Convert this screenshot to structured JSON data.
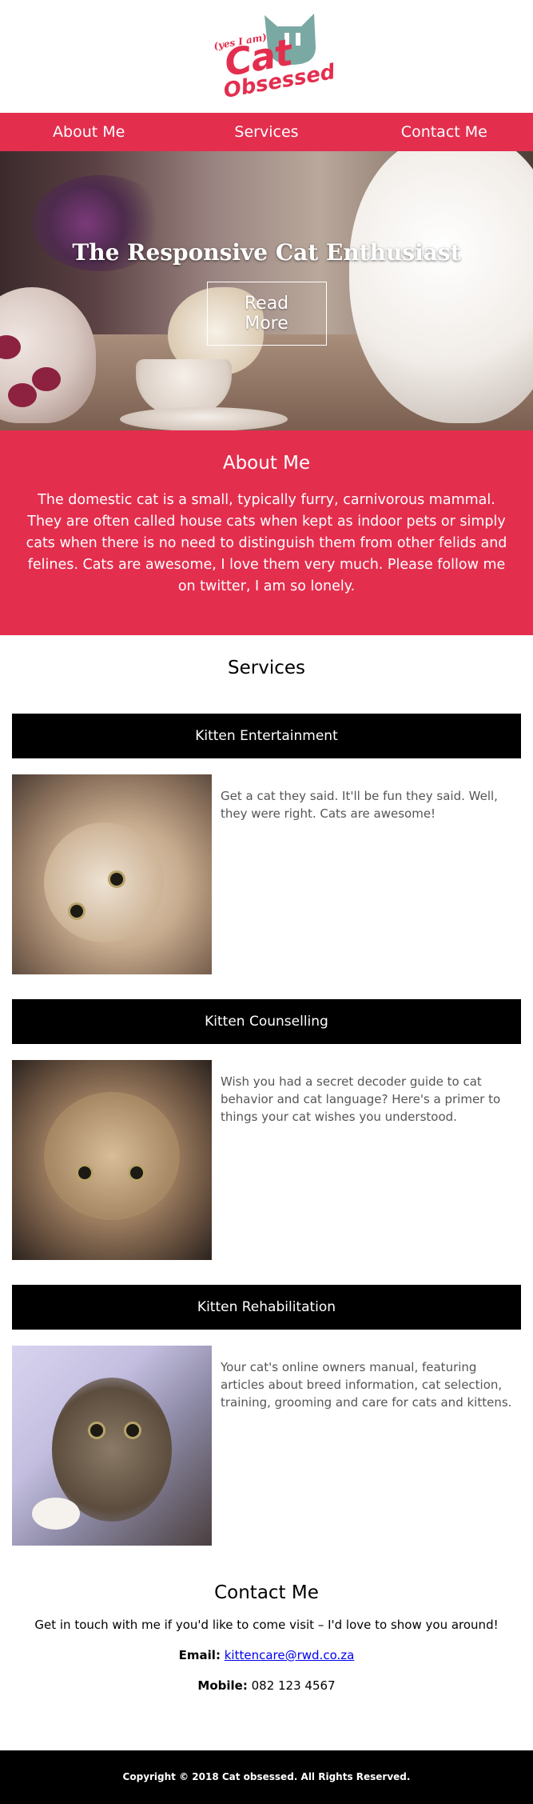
{
  "logo": {
    "tagline": "(yes I am)",
    "word1": "Cat",
    "word2": "Obsessed"
  },
  "nav": {
    "items": [
      {
        "label": "About Me"
      },
      {
        "label": "Services"
      },
      {
        "label": "Contact Me"
      }
    ]
  },
  "hero": {
    "title": "The Responsive Cat Enthusiast",
    "button_label": "Read More"
  },
  "about": {
    "title": "About Me",
    "text": "The domestic cat is a small, typically furry, carnivorous mammal. They are often called house cats when kept as indoor pets or simply cats when there is no need to distinguish them from other felids and felines. Cats are awesome, I love them very much. Please follow me on twitter, I am so lonely."
  },
  "services": {
    "title": "Services",
    "items": [
      {
        "heading": "Kitten Entertainment",
        "text": "Get a cat they said. It'll be fun they said. Well, they were right. Cats are awesome!"
      },
      {
        "heading": "Kitten Counselling",
        "text": "Wish you had a secret decoder guide to cat behavior and cat language? Here's a primer to things your cat wishes you understood."
      },
      {
        "heading": "Kitten Rehabilitation",
        "text": "Your cat's online owners manual, featuring articles about breed information, cat selection, training, grooming and care for cats and kittens."
      }
    ]
  },
  "contact": {
    "title": "Contact Me",
    "intro": "Get in touch with me if you'd like to come visit – I'd love to show you around!",
    "email_label": "Email:",
    "email": "kittencare@rwd.co.za",
    "mobile_label": "Mobile:",
    "mobile": "082 123 4567"
  },
  "footer": {
    "copyright": "Copyright © 2018 Cat obsessed. All Rights Reserved."
  },
  "colors": {
    "brand": "#e42e4e",
    "logo_teal": "#7aa8a2",
    "dark": "#000000"
  }
}
